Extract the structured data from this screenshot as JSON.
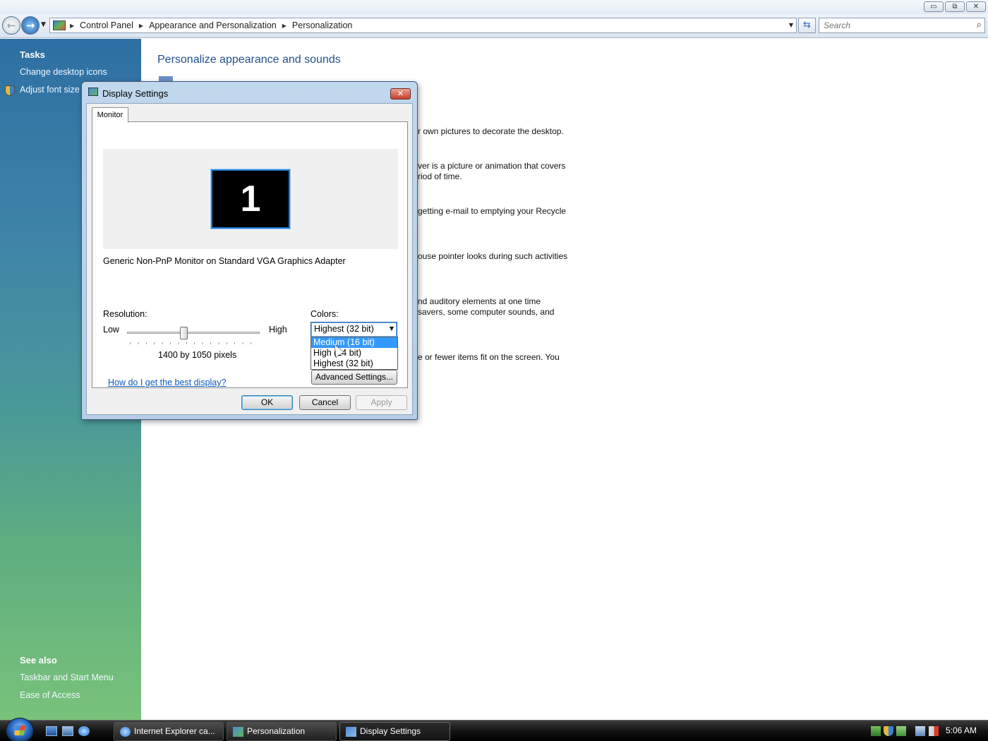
{
  "window": {
    "controls": {
      "minimize": "▭",
      "maximize": "⧉",
      "close": "✕"
    },
    "breadcrumb": [
      "Control Panel",
      "Appearance and Personalization",
      "Personalization"
    ],
    "search": {
      "placeholder": "Search"
    }
  },
  "task_pane": {
    "tasks_heading": "Tasks",
    "tasks": [
      "Change desktop icons",
      "Adjust font size ("
    ],
    "see_also_heading": "See also",
    "see_also": [
      "Taskbar and Start Menu",
      "Ease of Access"
    ]
  },
  "main": {
    "title": "Personalize appearance and sounds",
    "visible_fragments": [
      "r own pictures to decorate the desktop.",
      "ver is a picture or animation that covers",
      "riod of time.",
      "getting e-mail to emptying your Recycle",
      "ouse pointer looks during such activities",
      "nd auditory elements at one time",
      " savers, some computer sounds, and",
      "e or fewer items fit on the screen. You"
    ]
  },
  "dialog": {
    "title": "Display Settings",
    "close_glyph": "✕",
    "tab": "Monitor",
    "monitor_number": "1",
    "monitor_description": "Generic Non-PnP Monitor on Standard VGA Graphics Adapter",
    "resolution_label": "Resolution:",
    "low_label": "Low",
    "high_label": "High",
    "resolution_value": "1400 by 1050 pixels",
    "colors_label": "Colors:",
    "colors_selected": "Highest (32 bit)",
    "colors_options": [
      "Medium (16 bit)",
      "High (24 bit)",
      "Highest (32 bit)"
    ],
    "colors_highlighted": "Medium (16 bit)",
    "help_link": "How do I get the best display?",
    "advanced_button": "Advanced Settings...",
    "ok_button": "OK",
    "cancel_button": "Cancel",
    "apply_button": "Apply"
  },
  "taskbar": {
    "buttons": [
      "Internet Explorer ca...",
      "Personalization",
      "Display Settings"
    ],
    "active_button": "Display Settings",
    "clock": "5:06 AM"
  }
}
